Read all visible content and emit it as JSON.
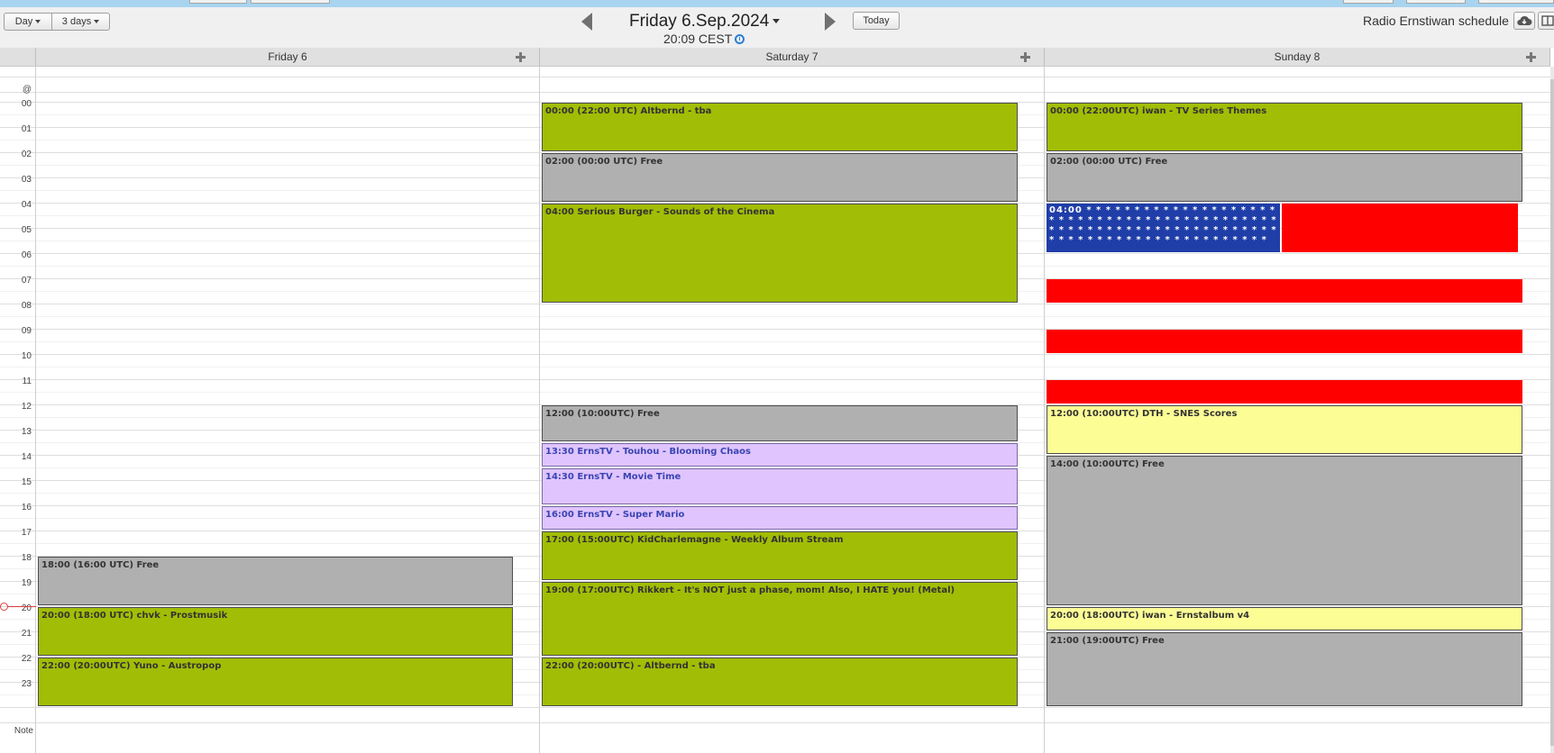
{
  "toolbar": {
    "view_day": "Day",
    "view_3days": "3 days",
    "today": "Today"
  },
  "title": {
    "date": "Friday 6.Sep.2024",
    "time": "20:09 CEST"
  },
  "schedule_name": "Radio Ernstiwan schedule",
  "icons": {
    "prev": "triangle-left-icon",
    "next": "triangle-right-icon",
    "clock": "clock-icon",
    "cloud": "cloud-download-icon",
    "layout": "columns-icon",
    "add": "plus-icon"
  },
  "columns": [
    {
      "label": "Friday 6"
    },
    {
      "label": "Saturday 7"
    },
    {
      "label": "Sunday 8"
    }
  ],
  "gutter": {
    "allday": "@",
    "hours": [
      "00",
      "01",
      "02",
      "03",
      "04",
      "05",
      "06",
      "07",
      "08",
      "09",
      "10",
      "11",
      "12",
      "13",
      "14",
      "15",
      "16",
      "17",
      "18",
      "19",
      "20",
      "21",
      "22",
      "23"
    ],
    "note": "Note"
  },
  "current_time_hour": 20.15,
  "events": {
    "friday": [
      {
        "label": "18:00 (16:00 UTC) Free",
        "start": 18,
        "end": 20,
        "color": "gray"
      },
      {
        "label": "20:00 (18:00 UTC) chvk - Prostmusik",
        "start": 20,
        "end": 22,
        "color": "green"
      },
      {
        "label": "22:00 (20:00UTC) Yuno - Austropop",
        "start": 22,
        "end": 24,
        "color": "green"
      }
    ],
    "saturday": [
      {
        "label": "00:00 (22:00 UTC) Altbernd - tba",
        "start": 0,
        "end": 2,
        "color": "green"
      },
      {
        "label": "02:00 (00:00 UTC) Free",
        "start": 2,
        "end": 4,
        "color": "gray"
      },
      {
        "label": "04:00 Serious Burger - Sounds of the Cinema",
        "start": 4,
        "end": 8,
        "color": "green"
      },
      {
        "label": "12:00 (10:00UTC) Free",
        "start": 12,
        "end": 13.5,
        "color": "gray"
      },
      {
        "label": "13:30 ErnsTV - Touhou - Blooming Chaos",
        "start": 13.5,
        "end": 14.5,
        "color": "lilac"
      },
      {
        "label": "14:30 ErnsTV - Movie Time",
        "start": 14.5,
        "end": 16,
        "color": "lilac"
      },
      {
        "label": "16:00 ErnsTV - Super Mario",
        "start": 16,
        "end": 17,
        "color": "lilac"
      },
      {
        "label": "17:00 (15:00UTC) KidCharlemagne - Weekly Album Stream",
        "start": 17,
        "end": 19,
        "color": "green"
      },
      {
        "label": "19:00 (17:00UTC) Rikkert - It's NOT just a phase, mom! Also, I HATE you! (Metal)",
        "start": 19,
        "end": 22,
        "color": "green"
      },
      {
        "label": "22:00 (20:00UTC) - Altbernd - tba",
        "start": 22,
        "end": 24,
        "color": "green"
      }
    ],
    "sunday": [
      {
        "label": "00:00 (22:00UTC) iwan - TV Series Themes",
        "start": 0,
        "end": 2,
        "color": "green"
      },
      {
        "label": "02:00 (00:00 UTC) Free",
        "start": 2,
        "end": 4,
        "color": "gray"
      },
      {
        "label": "04:00 * * * * * * * * * * * * * * * * * * * * * * * * * * * * * * * * * * * * * * * * * * * * * * * * * * * * * * * * * * * * * * * * * * * * * * * * * * * * * * * * * * * * * * * * * * *",
        "start": 4,
        "end": 6,
        "color": "flag"
      },
      {
        "label": "",
        "start": 4,
        "end": 6,
        "color": "red"
      },
      {
        "label": "",
        "start": 7,
        "end": 8,
        "color": "red"
      },
      {
        "label": "",
        "start": 9,
        "end": 10,
        "color": "red"
      },
      {
        "label": "",
        "start": 11,
        "end": 12,
        "color": "red"
      },
      {
        "label": "12:00 (10:00UTC) DTH - SNES Scores",
        "start": 12,
        "end": 14,
        "color": "yellow"
      },
      {
        "label": "14:00 (10:00UTC) Free",
        "start": 14,
        "end": 20,
        "color": "gray"
      },
      {
        "label": "20:00 (18:00UTC) iwan - Ernstalbum v4",
        "start": 20,
        "end": 21,
        "color": "yellow"
      },
      {
        "label": "21:00 (19:00UTC) Free",
        "start": 21,
        "end": 24,
        "color": "gray"
      }
    ]
  }
}
